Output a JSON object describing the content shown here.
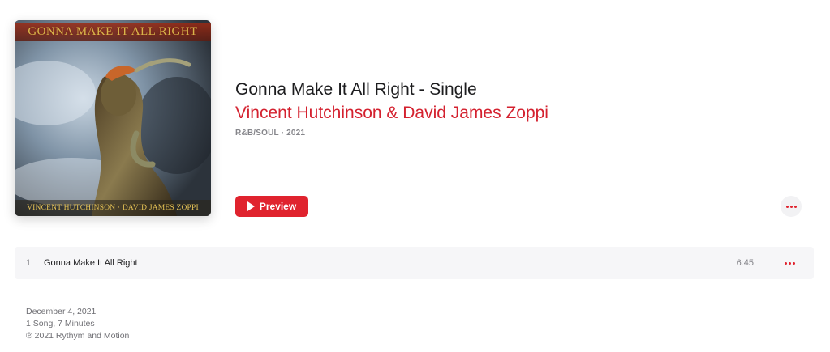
{
  "album": {
    "artwork": {
      "top_text": "GONNA MAKE IT ALL RIGHT",
      "bottom_text": "VINCENT HUTCHINSON · DAVID JAMES ZOPPI"
    },
    "title": "Gonna Make It All Right - Single",
    "artist": "Vincent Hutchinson & David James Zoppi",
    "genre_year": "R&B/SOUL · 2021",
    "preview_label": "Preview",
    "accent_color": "#e0232e"
  },
  "tracks": [
    {
      "number": "1",
      "title": "Gonna Make It All Right",
      "duration": "6:45"
    }
  ],
  "footer": {
    "release_date": "December 4, 2021",
    "summary": "1 Song, 7 Minutes",
    "copyright": "℗ 2021 Rythym and Motion"
  },
  "icons": {
    "play": "play-icon",
    "more": "more-icon"
  }
}
